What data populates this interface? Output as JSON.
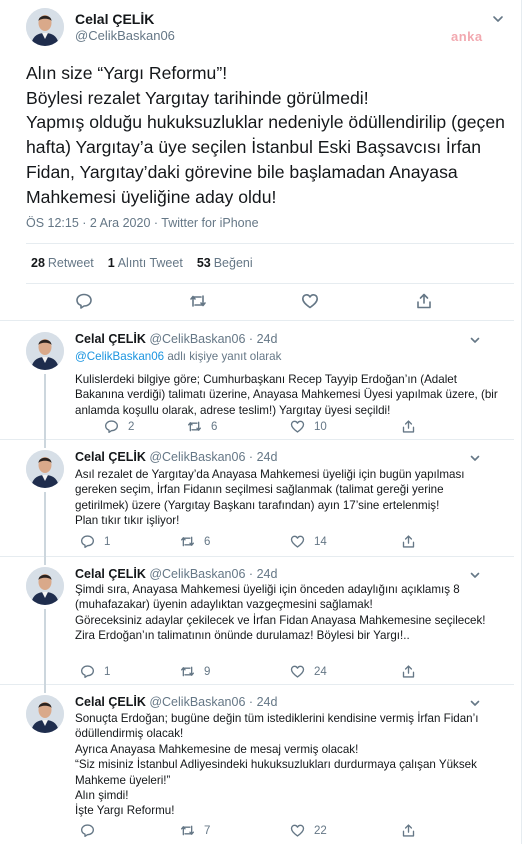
{
  "main_tweet": {
    "author_name": "Celal ÇELİK",
    "author_handle": "@CelikBaskan06",
    "watermark": "anka",
    "text": "Alın size “Yargı Reformu”!\nBöylesi rezalet Yargıtay tarihinde görülmedi!\nYapmış olduğu hukuksuzluklar nedeniyle ödüllendirilip (geçen hafta) Yargıtay’a üye seçilen İstanbul Eski Başsavcısı İrfan Fidan, Yargıtay’daki görevine bile başlamadan Anayasa Mahkemesi üyeliğine aday oldu!",
    "meta": "ÖS 12:15 · 2 Ara 2020 · Twitter for iPhone",
    "retweet_count": "28",
    "retweet_label": "Retweet",
    "quote_count": "1",
    "quote_label": "Alıntı Tweet",
    "like_count": "53",
    "like_label": "Beğeni",
    "icons": [
      "reply-icon",
      "retweet-icon",
      "like-icon",
      "share-icon"
    ]
  },
  "replies": [
    {
      "name": "Celal ÇELİK",
      "handle": "@CelikBaskan06",
      "dot": "·",
      "time": "24d",
      "replying_mention": "@CelikBaskan06",
      "replying_suffix": " adlı kişiye yanıt olarak",
      "text": "Kulislerdeki bilgiye göre; Cumhurbaşkanı Recep Tayyip Erdoğan’ın (Adalet Bakanına verdiği) talimatı üzerine, Anayasa Mahkemesi Üyesi yapılmak üzere, (bir anlamda koşullu olarak, adrese teslim!) Yargıtay üyesi seçildi!",
      "reply_count": "2",
      "retweet_count": "6",
      "like_count": "10"
    },
    {
      "name": "Celal ÇELİK",
      "handle": "@CelikBaskan06",
      "dot": "·",
      "time": "24d",
      "text": "Asıl rezalet de Yargıtay’da Anayasa Mahkemesi üyeliği için bugün yapılması gereken seçim, İrfan Fidanın seçilmesi sağlanmak (talimat gereği yerine getirilmek) üzere (Yargıtay Başkanı tarafından) ayın 17’sine ertelenmiş!\nPlan tıkır tıkır işliyor!",
      "reply_count": "1",
      "retweet_count": "6",
      "like_count": "14"
    },
    {
      "name": "Celal ÇELİK",
      "handle": "@CelikBaskan06",
      "dot": "·",
      "time": "24d",
      "text": "Şimdi sıra, Anayasa Mahkemesi üyeliği için önceden adaylığını açıklamış 8 (muhafazakar) üyenin adaylıktan vazgeçmesini sağlamak!\nGöreceksiniz adaylar çekilecek ve İrfan Fidan Anayasa Mahkemesine seçilecek!\nZira Erdoğan’ın talimatının önünde durulamaz! Böylesi bir Yargı!..",
      "reply_count": "1",
      "retweet_count": "9",
      "like_count": "24"
    },
    {
      "name": "Celal ÇELİK",
      "handle": "@CelikBaskan06",
      "dot": "·",
      "time": "24d",
      "text": "Sonuçta Erdoğan; bugüne değin tüm istediklerini kendisine vermiş İrfan Fidan’ı ödüllendirmiş olacak!\nAyrıca Anayasa Mahkemesine de mesaj vermiş olacak!\n“Siz misiniz İstanbul Adliyesindeki hukuksuzlukları durdurmaya çalışan Yüksek Mahkeme üyeleri!”\nAlın şimdi!\nİşte Yargı Reformu!",
      "reply_count": "",
      "retweet_count": "7",
      "like_count": "22"
    }
  ]
}
